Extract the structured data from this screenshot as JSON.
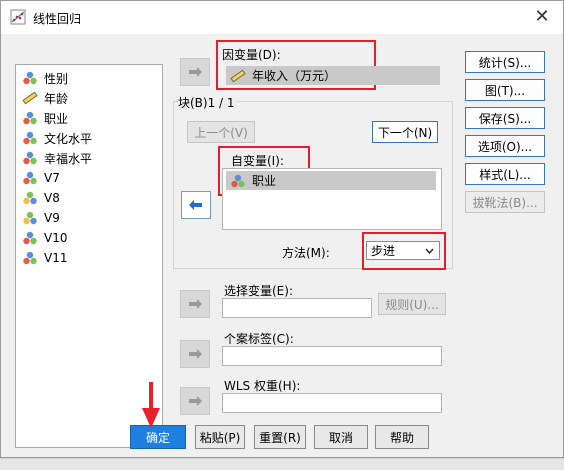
{
  "window": {
    "title": "线性回归",
    "close_glyph": "✕"
  },
  "variables": [
    {
      "name": "性别",
      "icon": "nominal-icon"
    },
    {
      "name": "年龄",
      "icon": "scale-ruler-icon"
    },
    {
      "name": "职业",
      "icon": "nominal-icon"
    },
    {
      "name": "文化水平",
      "icon": "nominal-icon"
    },
    {
      "name": "幸福水平",
      "icon": "nominal-icon"
    },
    {
      "name": "V7",
      "icon": "nominal-icon"
    },
    {
      "name": "V8",
      "icon": "ordinal-icon"
    },
    {
      "name": "V9",
      "icon": "ordinal-icon"
    },
    {
      "name": "V10",
      "icon": "nominal-icon"
    },
    {
      "name": "V11",
      "icon": "nominal-icon"
    }
  ],
  "dependent": {
    "label": "因变量(D):",
    "value": "年收入（万元）"
  },
  "block": {
    "label": "块(B)1 / 1",
    "prev": "上一个(V)",
    "next": "下一个(N)"
  },
  "independent": {
    "label": "自变量(I):",
    "value": "职业"
  },
  "method": {
    "label": "方法(M):",
    "value": "步进"
  },
  "selection": {
    "label": "选择变量(E):",
    "rule": "规则(U)..."
  },
  "case_label": {
    "label": "个案标签(C):"
  },
  "wls": {
    "label": "WLS 权重(H):"
  },
  "side_buttons": [
    "统计(S)...",
    "图(T)...",
    "保存(S)...",
    "选项(O)...",
    "样式(L)...",
    "拔靴法(B)..."
  ],
  "bottom_buttons": {
    "ok": "确定",
    "paste": "粘贴(P)",
    "reset": "重置(R)",
    "cancel": "取消",
    "help": "帮助"
  },
  "colors": {
    "accent": "#1e7fe0",
    "highlight": "#e0202a",
    "annotation_arrow": "#e8202a"
  }
}
